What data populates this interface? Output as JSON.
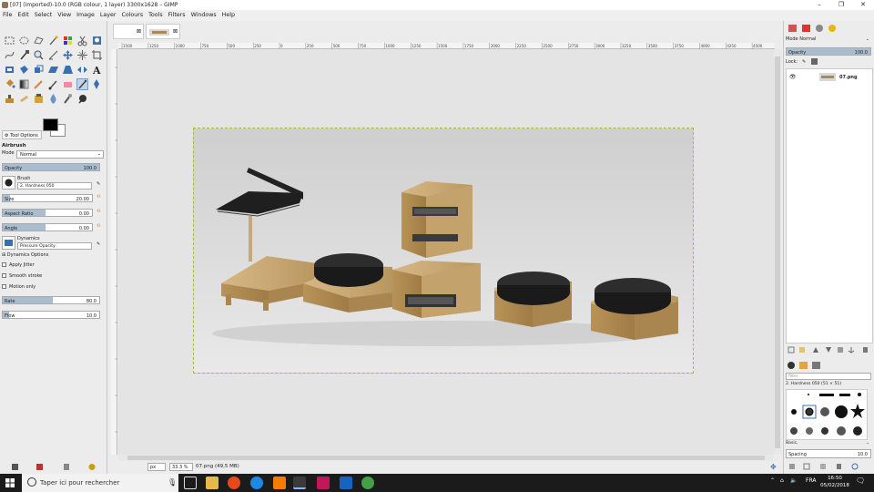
{
  "window": {
    "title": "[07] (imported)-10.0 (RGB colour, 1 layer) 3300x1628 – GIMP",
    "min_glyph": "–",
    "max_glyph": "❐",
    "close_glyph": "✕"
  },
  "menu": [
    "File",
    "Edit",
    "Select",
    "View",
    "Image",
    "Layer",
    "Colours",
    "Tools",
    "Filters",
    "Windows",
    "Help"
  ],
  "tool_options": {
    "tab_label": "Tool Options",
    "tool_name": "Airbrush",
    "mode_label": "Mode",
    "mode_value": "Normal",
    "opacity_label": "Opacity",
    "opacity_value": "100.0",
    "brush_label": "Brush",
    "brush_value": "2. Hardness 050",
    "size_label": "Size",
    "size_value": "20.00",
    "aspect_label": "Aspect Ratio",
    "aspect_value": "0.00",
    "angle_label": "Angle",
    "angle_value": "0.00",
    "dynamics_label": "Dynamics",
    "dynamics_value": "Pressure Opacity",
    "dynamics_options": "Dynamics Options",
    "apply_jitter": "Apply Jitter",
    "smooth_stroke": "Smooth stroke",
    "motion_only": "Motion only",
    "rate_label": "Rate",
    "rate_value": "80.0",
    "flow_label": "Flow",
    "flow_value": "10.0"
  },
  "ruler_ticks": [
    "1500",
    "1250",
    "1000",
    "750",
    "500",
    "250",
    "0",
    "250",
    "500",
    "750",
    "1000",
    "1250",
    "1500",
    "1750",
    "2000",
    "2250",
    "2500",
    "2750",
    "3000",
    "3250",
    "3500",
    "3750",
    "4000",
    "4250",
    "4500"
  ],
  "status": {
    "unit": "px",
    "zoom": "33.3 %",
    "info": "07.png (49,5 MB)"
  },
  "layers": {
    "mode_label": "Mode",
    "mode_value": "Normal",
    "opacity_label": "Opacity",
    "opacity_value": "100.0",
    "lock_label": "Lock:",
    "layer_name": "07.png"
  },
  "brushes": {
    "filter_placeholder": "filter",
    "current": "2. Hardness 050 (51 × 51)",
    "tag": "Basic,",
    "spacing_label": "Spacing",
    "spacing_value": "10.0"
  },
  "taskbar": {
    "search_placeholder": "Taper ici pour rechercher",
    "lang": "FRA",
    "time": "16:50",
    "date": "05/02/2018"
  },
  "colors": {
    "accent": "#a9bdd0",
    "wood": "#c9a874",
    "wood_dark": "#a5844f",
    "disk": "#222222"
  }
}
